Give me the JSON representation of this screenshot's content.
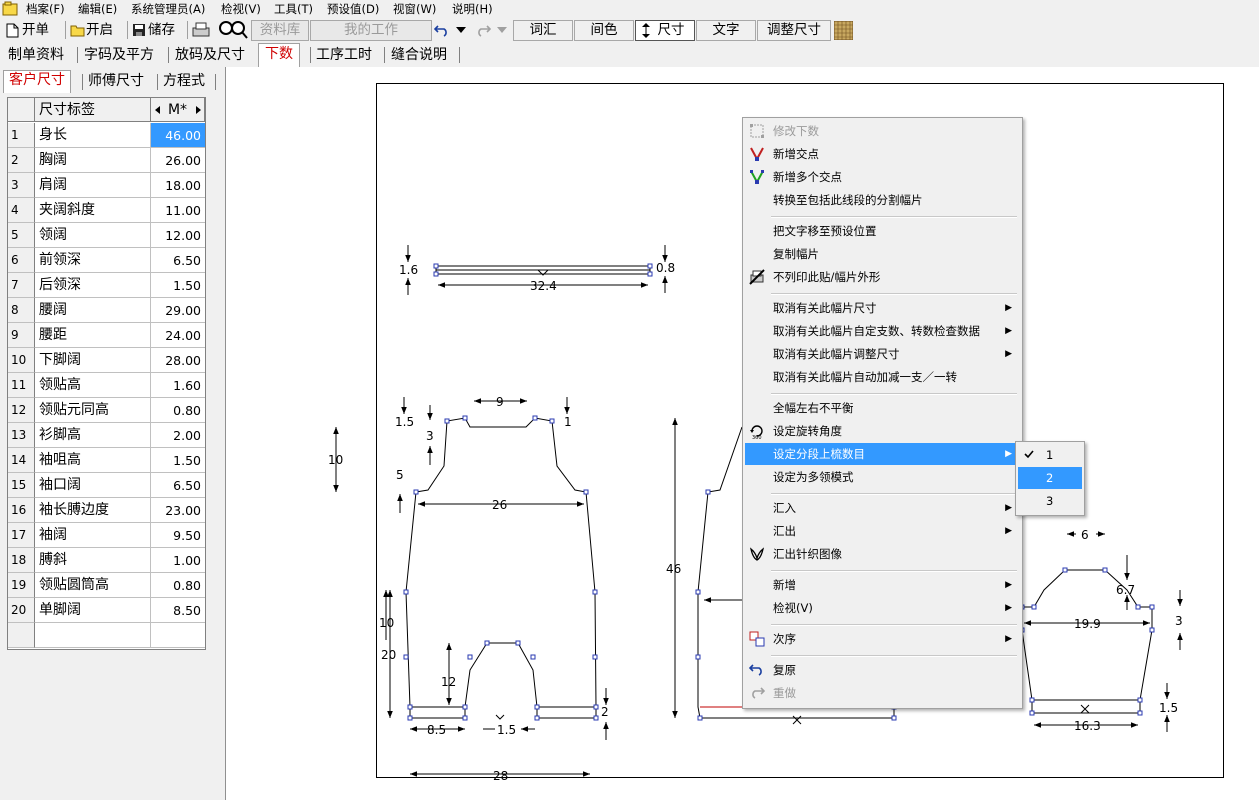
{
  "menubar": {
    "items": [
      "档案(F)",
      "编辑(E)",
      "系统管理员(A)",
      "检视(V)",
      "工具(T)",
      "预设值(D)",
      "视窗(W)",
      "说明(H)"
    ]
  },
  "toolbar": {
    "new_label": "开单",
    "open_label": "开启",
    "save_label": "储存",
    "database_label": "资料库",
    "mywork_label": "我的工作",
    "vocab_label": "词汇",
    "color_label": "间色",
    "size_label": "尺寸",
    "text_label": "文字",
    "adjust_label": "调整尺寸"
  },
  "main_tabs": [
    "制单资料",
    "字码及平方",
    "放码及尺寸",
    "下数",
    "工序工时",
    "缝合说明"
  ],
  "sub_tabs": [
    "客户尺寸",
    "师傅尺寸",
    "方程式"
  ],
  "grid": {
    "header_label": "尺寸标签",
    "header_size": "M*",
    "rows": [
      {
        "n": "1",
        "label": "身长",
        "value": "46.00"
      },
      {
        "n": "2",
        "label": "胸阔",
        "value": "26.00"
      },
      {
        "n": "3",
        "label": "肩阔",
        "value": "18.00"
      },
      {
        "n": "4",
        "label": "夹阔斜度",
        "value": "11.00"
      },
      {
        "n": "5",
        "label": "领阔",
        "value": "12.00"
      },
      {
        "n": "6",
        "label": "前领深",
        "value": "6.50"
      },
      {
        "n": "7",
        "label": "后领深",
        "value": "1.50"
      },
      {
        "n": "8",
        "label": "腰阔",
        "value": "29.00"
      },
      {
        "n": "9",
        "label": "腰距",
        "value": "24.00"
      },
      {
        "n": "10",
        "label": "下脚阔",
        "value": "28.00"
      },
      {
        "n": "11",
        "label": "领贴高",
        "value": "1.60"
      },
      {
        "n": "12",
        "label": "领贴元同高",
        "value": "0.80"
      },
      {
        "n": "13",
        "label": "衫脚高",
        "value": "2.00"
      },
      {
        "n": "14",
        "label": "袖咀高",
        "value": "1.50"
      },
      {
        "n": "15",
        "label": "袖口阔",
        "value": "6.50"
      },
      {
        "n": "16",
        "label": "袖长膊边度",
        "value": "23.00"
      },
      {
        "n": "17",
        "label": "袖阔",
        "value": "9.50"
      },
      {
        "n": "18",
        "label": "膊斜",
        "value": "1.00"
      },
      {
        "n": "19",
        "label": "领贴圆筒高",
        "value": "0.80"
      },
      {
        "n": "20",
        "label": "单脚阔",
        "value": "8.50"
      }
    ]
  },
  "context_menu": {
    "items": [
      {
        "label": "修改下数",
        "icon": "edit-points-icon",
        "disabled": true
      },
      {
        "label": "新增交点",
        "icon": "add-node-icon"
      },
      {
        "label": "新增多个交点",
        "icon": "add-nodes-icon"
      },
      {
        "label": "转换至包括此线段的分割幅片"
      },
      {
        "label": "把文字移至预设位置"
      },
      {
        "label": "复制幅片"
      },
      {
        "label": "不列印此贴/幅片外形",
        "icon": "no-print-icon"
      },
      {
        "label": "取消有关此幅片尺寸",
        "submenu": true
      },
      {
        "label": "取消有关此幅片自定支数、转数检查数据",
        "submenu": true
      },
      {
        "label": "取消有关此幅片调整尺寸",
        "submenu": true
      },
      {
        "label": "取消有关此幅片自动加减一支／一转"
      },
      {
        "label": "全幅左右不平衡"
      },
      {
        "label": "设定旋转角度",
        "icon": "rotate-360-icon"
      },
      {
        "label": "设定分段上梳数目",
        "submenu": true,
        "highlighted": true
      },
      {
        "label": "设定为多领模式"
      },
      {
        "label": "汇入",
        "submenu": true
      },
      {
        "label": "汇出",
        "submenu": true
      },
      {
        "label": "汇出针织图像",
        "icon": "knit-image-icon"
      },
      {
        "label": "新增",
        "submenu": true
      },
      {
        "label": "检视(V)",
        "submenu": true
      },
      {
        "label": "次序",
        "icon": "order-icon",
        "submenu": true
      },
      {
        "label": "复原",
        "icon": "undo-icon"
      },
      {
        "label": "重做",
        "icon": "redo-icon",
        "disabled": true
      }
    ]
  },
  "submenu": {
    "items": [
      {
        "label": "1",
        "checked": true
      },
      {
        "label": "2",
        "highlighted": true
      },
      {
        "label": "3"
      }
    ]
  },
  "drawing_labels": {
    "collar_h_left": "1.6",
    "collar_h_right": "0.8",
    "collar_w": "32.4",
    "front_neck_w": "9",
    "front_left_15": "1.5",
    "front_left_3": "3",
    "front_shoulder_1": "1",
    "front_armhole_10": "10",
    "front_left_5": "5",
    "front_chest_26": "26",
    "front_side_10": "10",
    "front_side_20": "20",
    "front_leg_12": "12",
    "front_hem_2": "2",
    "front_leg_85": "8.5",
    "front_crotch_15": "1.5",
    "front_bottom_28": "28",
    "back_length_46": "46",
    "sleeve_6": "6",
    "sleeve_67": "6.7",
    "sleeve_199": "19.9",
    "sleeve_3": "3",
    "sleeve_15": "1.5",
    "sleeve_163": "16.3"
  },
  "colors": {
    "selection": "#3399ff",
    "active_tab_text": "#d00000",
    "menu_bg": "#f0f0f0"
  }
}
